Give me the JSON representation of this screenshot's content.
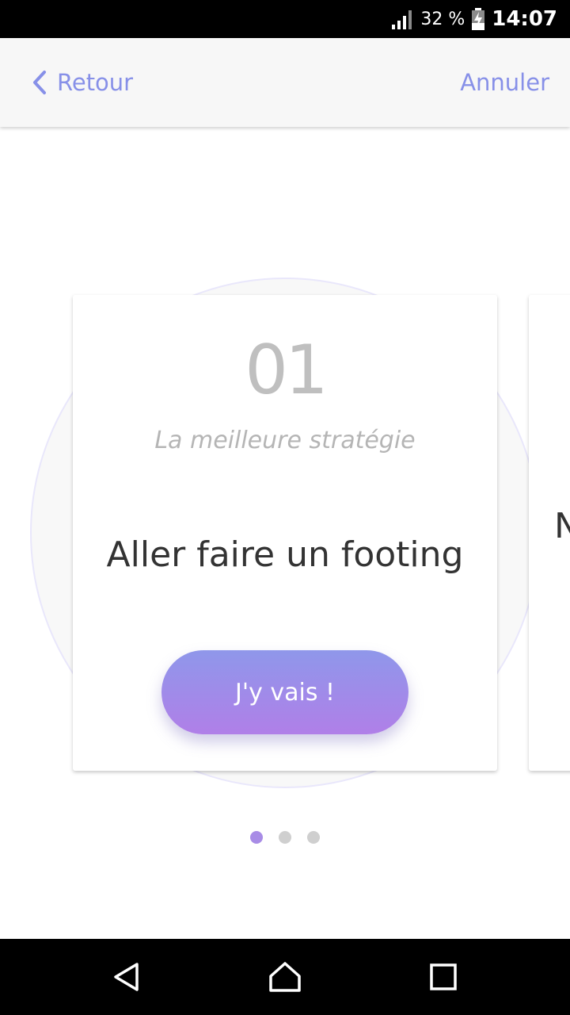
{
  "status_bar": {
    "battery_percent": "32 %",
    "time": "14:07",
    "icons": [
      "signal-icon",
      "battery-charging-icon"
    ]
  },
  "header": {
    "back_label": "Retour",
    "cancel_label": "Annuler",
    "accent_color": "#8790e8"
  },
  "cards": [
    {
      "number": "01",
      "subtitle": "La meilleure stratégie",
      "title": "Aller faire un footing",
      "cta_label": "J'y vais !"
    },
    {
      "title": "N"
    }
  ],
  "pagination": {
    "total": 3,
    "active_index": 0,
    "active_color": "#a88ce6",
    "inactive_color": "#cfcfcf"
  },
  "nav_bar": {
    "icons": [
      "back-triangle-icon",
      "home-icon",
      "recents-icon"
    ]
  }
}
